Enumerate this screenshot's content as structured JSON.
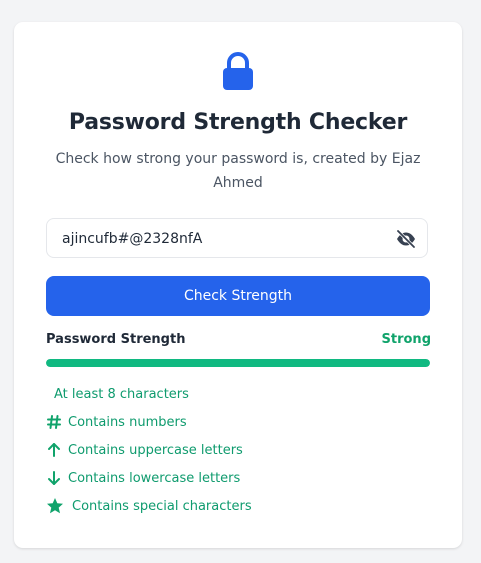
{
  "header": {
    "title": "Password Strength Checker",
    "subtitle": "Check how strong your password is, created by Ejaz Ahmed"
  },
  "password_field": {
    "value": "ajincufb#@2328nfA",
    "visibility_icon": "eye-slash-icon"
  },
  "check_button_label": "Check Strength",
  "strength": {
    "label": "Password Strength",
    "value": "Strong",
    "fraction": 1.0,
    "color": "#10b981"
  },
  "requirements": [
    {
      "label": "At least 8 characters",
      "icon": "none"
    },
    {
      "label": "Contains numbers",
      "icon": "hash-icon"
    },
    {
      "label": "Contains uppercase letters",
      "icon": "arrow-up-icon"
    },
    {
      "label": "Contains lowercase letters",
      "icon": "arrow-down-icon"
    },
    {
      "label": "Contains special characters",
      "icon": "star-icon"
    }
  ],
  "colors": {
    "accent": "#2563eb",
    "success": "#10b981",
    "text_dark": "#1f2937",
    "text_muted": "#4b5563"
  }
}
